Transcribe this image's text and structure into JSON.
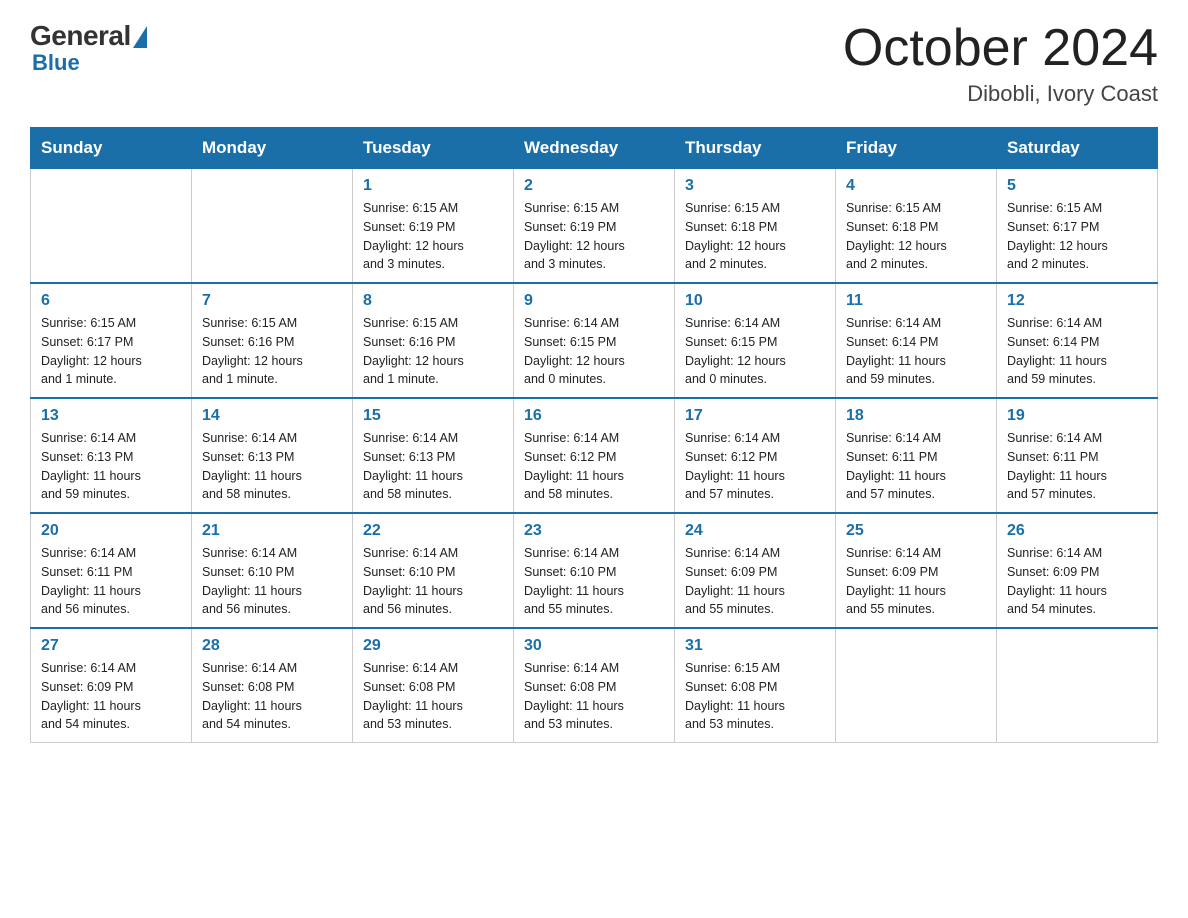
{
  "logo": {
    "general": "General",
    "blue": "Blue"
  },
  "title": "October 2024",
  "subtitle": "Dibobli, Ivory Coast",
  "days_of_week": [
    "Sunday",
    "Monday",
    "Tuesday",
    "Wednesday",
    "Thursday",
    "Friday",
    "Saturday"
  ],
  "weeks": [
    [
      {
        "day": "",
        "info": ""
      },
      {
        "day": "",
        "info": ""
      },
      {
        "day": "1",
        "info": "Sunrise: 6:15 AM\nSunset: 6:19 PM\nDaylight: 12 hours\nand 3 minutes."
      },
      {
        "day": "2",
        "info": "Sunrise: 6:15 AM\nSunset: 6:19 PM\nDaylight: 12 hours\nand 3 minutes."
      },
      {
        "day": "3",
        "info": "Sunrise: 6:15 AM\nSunset: 6:18 PM\nDaylight: 12 hours\nand 2 minutes."
      },
      {
        "day": "4",
        "info": "Sunrise: 6:15 AM\nSunset: 6:18 PM\nDaylight: 12 hours\nand 2 minutes."
      },
      {
        "day": "5",
        "info": "Sunrise: 6:15 AM\nSunset: 6:17 PM\nDaylight: 12 hours\nand 2 minutes."
      }
    ],
    [
      {
        "day": "6",
        "info": "Sunrise: 6:15 AM\nSunset: 6:17 PM\nDaylight: 12 hours\nand 1 minute."
      },
      {
        "day": "7",
        "info": "Sunrise: 6:15 AM\nSunset: 6:16 PM\nDaylight: 12 hours\nand 1 minute."
      },
      {
        "day": "8",
        "info": "Sunrise: 6:15 AM\nSunset: 6:16 PM\nDaylight: 12 hours\nand 1 minute."
      },
      {
        "day": "9",
        "info": "Sunrise: 6:14 AM\nSunset: 6:15 PM\nDaylight: 12 hours\nand 0 minutes."
      },
      {
        "day": "10",
        "info": "Sunrise: 6:14 AM\nSunset: 6:15 PM\nDaylight: 12 hours\nand 0 minutes."
      },
      {
        "day": "11",
        "info": "Sunrise: 6:14 AM\nSunset: 6:14 PM\nDaylight: 11 hours\nand 59 minutes."
      },
      {
        "day": "12",
        "info": "Sunrise: 6:14 AM\nSunset: 6:14 PM\nDaylight: 11 hours\nand 59 minutes."
      }
    ],
    [
      {
        "day": "13",
        "info": "Sunrise: 6:14 AM\nSunset: 6:13 PM\nDaylight: 11 hours\nand 59 minutes."
      },
      {
        "day": "14",
        "info": "Sunrise: 6:14 AM\nSunset: 6:13 PM\nDaylight: 11 hours\nand 58 minutes."
      },
      {
        "day": "15",
        "info": "Sunrise: 6:14 AM\nSunset: 6:13 PM\nDaylight: 11 hours\nand 58 minutes."
      },
      {
        "day": "16",
        "info": "Sunrise: 6:14 AM\nSunset: 6:12 PM\nDaylight: 11 hours\nand 58 minutes."
      },
      {
        "day": "17",
        "info": "Sunrise: 6:14 AM\nSunset: 6:12 PM\nDaylight: 11 hours\nand 57 minutes."
      },
      {
        "day": "18",
        "info": "Sunrise: 6:14 AM\nSunset: 6:11 PM\nDaylight: 11 hours\nand 57 minutes."
      },
      {
        "day": "19",
        "info": "Sunrise: 6:14 AM\nSunset: 6:11 PM\nDaylight: 11 hours\nand 57 minutes."
      }
    ],
    [
      {
        "day": "20",
        "info": "Sunrise: 6:14 AM\nSunset: 6:11 PM\nDaylight: 11 hours\nand 56 minutes."
      },
      {
        "day": "21",
        "info": "Sunrise: 6:14 AM\nSunset: 6:10 PM\nDaylight: 11 hours\nand 56 minutes."
      },
      {
        "day": "22",
        "info": "Sunrise: 6:14 AM\nSunset: 6:10 PM\nDaylight: 11 hours\nand 56 minutes."
      },
      {
        "day": "23",
        "info": "Sunrise: 6:14 AM\nSunset: 6:10 PM\nDaylight: 11 hours\nand 55 minutes."
      },
      {
        "day": "24",
        "info": "Sunrise: 6:14 AM\nSunset: 6:09 PM\nDaylight: 11 hours\nand 55 minutes."
      },
      {
        "day": "25",
        "info": "Sunrise: 6:14 AM\nSunset: 6:09 PM\nDaylight: 11 hours\nand 55 minutes."
      },
      {
        "day": "26",
        "info": "Sunrise: 6:14 AM\nSunset: 6:09 PM\nDaylight: 11 hours\nand 54 minutes."
      }
    ],
    [
      {
        "day": "27",
        "info": "Sunrise: 6:14 AM\nSunset: 6:09 PM\nDaylight: 11 hours\nand 54 minutes."
      },
      {
        "day": "28",
        "info": "Sunrise: 6:14 AM\nSunset: 6:08 PM\nDaylight: 11 hours\nand 54 minutes."
      },
      {
        "day": "29",
        "info": "Sunrise: 6:14 AM\nSunset: 6:08 PM\nDaylight: 11 hours\nand 53 minutes."
      },
      {
        "day": "30",
        "info": "Sunrise: 6:14 AM\nSunset: 6:08 PM\nDaylight: 11 hours\nand 53 minutes."
      },
      {
        "day": "31",
        "info": "Sunrise: 6:15 AM\nSunset: 6:08 PM\nDaylight: 11 hours\nand 53 minutes."
      },
      {
        "day": "",
        "info": ""
      },
      {
        "day": "",
        "info": ""
      }
    ]
  ]
}
